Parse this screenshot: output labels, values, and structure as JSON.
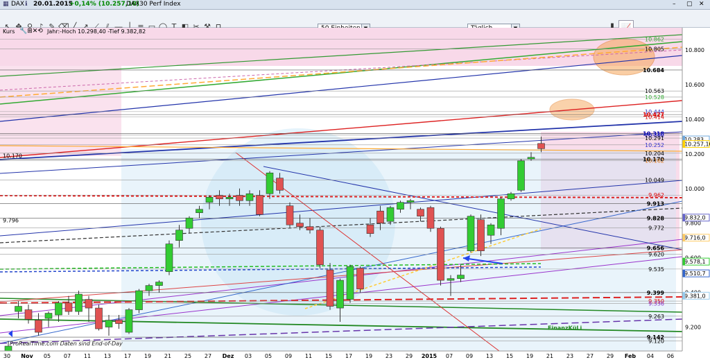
{
  "window": {
    "symbol": "DAX",
    "info_icon": "info-icon",
    "date": "20.01.2015",
    "change": "+0,14% (10.257,10)",
    "title": "DAX30 Perf Index"
  },
  "toolbar": {
    "units_select": "50 Einheiten",
    "period_select": "Täglich"
  },
  "panel": {
    "kurs_label": "Kurs",
    "stats": "Jahr:-Hoch 10.298,40 -Tief 9.382,82"
  },
  "watermark": "ProRealTime.com  Daten sind End-of-Day",
  "colors": {
    "up": "#33cc33",
    "down": "#e05252",
    "pink_zone": "#f6cfe3",
    "blue_zone": "#cfe6f7"
  },
  "chart_data": {
    "type": "candlestick",
    "title": "",
    "x_ticks": [
      "30",
      "Nov",
      "05",
      "07",
      "11",
      "13",
      "17",
      "19",
      "21",
      "25",
      "27",
      "Dez",
      "03",
      "05",
      "09",
      "11",
      "15",
      "17",
      "19",
      "23",
      "29",
      "2015",
      "07",
      "09",
      "13",
      "15",
      "19",
      "21",
      "23",
      "27",
      "29",
      "Feb",
      "04",
      "06"
    ],
    "y_ticks": [
      9200,
      9400,
      9600,
      9800,
      10000,
      10200,
      10400,
      10600,
      10800
    ],
    "ylim": [
      9070,
      10880
    ],
    "candles": [
      {
        "o": 9030,
        "h": 9120,
        "l": 9000,
        "c": 9090
      },
      {
        "o": 9290,
        "h": 9350,
        "l": 9250,
        "c": 9320
      },
      {
        "o": 9300,
        "h": 9330,
        "l": 9220,
        "c": 9245
      },
      {
        "o": 9240,
        "h": 9280,
        "l": 9150,
        "c": 9170
      },
      {
        "o": 9250,
        "h": 9290,
        "l": 9200,
        "c": 9280
      },
      {
        "o": 9270,
        "h": 9350,
        "l": 9230,
        "c": 9340
      },
      {
        "o": 9340,
        "h": 9380,
        "l": 9270,
        "c": 9290
      },
      {
        "o": 9290,
        "h": 9410,
        "l": 9270,
        "c": 9390
      },
      {
        "o": 9360,
        "h": 9380,
        "l": 9230,
        "c": 9310
      },
      {
        "o": 9310,
        "h": 9330,
        "l": 9180,
        "c": 9190
      },
      {
        "o": 9200,
        "h": 9270,
        "l": 9150,
        "c": 9240
      },
      {
        "o": 9240,
        "h": 9270,
        "l": 9190,
        "c": 9220
      },
      {
        "o": 9170,
        "h": 9310,
        "l": 9160,
        "c": 9300
      },
      {
        "o": 9300,
        "h": 9420,
        "l": 9280,
        "c": 9410
      },
      {
        "o": 9410,
        "h": 9450,
        "l": 9380,
        "c": 9440
      },
      {
        "o": 9440,
        "h": 9470,
        "l": 9400,
        "c": 9460
      },
      {
        "o": 9520,
        "h": 9700,
        "l": 9500,
        "c": 9680
      },
      {
        "o": 9700,
        "h": 9790,
        "l": 9660,
        "c": 9760
      },
      {
        "o": 9770,
        "h": 9840,
        "l": 9740,
        "c": 9830
      },
      {
        "o": 9860,
        "h": 9900,
        "l": 9830,
        "c": 9880
      },
      {
        "o": 9920,
        "h": 9960,
        "l": 9880,
        "c": 9950
      },
      {
        "o": 9960,
        "h": 9990,
        "l": 9900,
        "c": 9940
      },
      {
        "o": 9940,
        "h": 9970,
        "l": 9900,
        "c": 9950
      },
      {
        "o": 9960,
        "h": 10000,
        "l": 9900,
        "c": 9930
      },
      {
        "o": 9930,
        "h": 9990,
        "l": 9900,
        "c": 9970
      },
      {
        "o": 9960,
        "h": 9990,
        "l": 9840,
        "c": 9850
      },
      {
        "o": 9970,
        "h": 10100,
        "l": 9940,
        "c": 10090
      },
      {
        "o": 10060,
        "h": 10090,
        "l": 9970,
        "c": 9990
      },
      {
        "o": 9900,
        "h": 9920,
        "l": 9770,
        "c": 9790
      },
      {
        "o": 9800,
        "h": 9850,
        "l": 9760,
        "c": 9780
      },
      {
        "o": 9780,
        "h": 9830,
        "l": 9740,
        "c": 9760
      },
      {
        "o": 9760,
        "h": 9780,
        "l": 9540,
        "c": 9560
      },
      {
        "o": 9530,
        "h": 9570,
        "l": 9300,
        "c": 9320
      },
      {
        "o": 9310,
        "h": 9480,
        "l": 9230,
        "c": 9470
      },
      {
        "o": 9360,
        "h": 9560,
        "l": 9340,
        "c": 9550
      },
      {
        "o": 9540,
        "h": 9550,
        "l": 9400,
        "c": 9420
      },
      {
        "o": 9790,
        "h": 9830,
        "l": 9720,
        "c": 9740
      },
      {
        "o": 9870,
        "h": 9900,
        "l": 9760,
        "c": 9800
      },
      {
        "o": 9810,
        "h": 9900,
        "l": 9790,
        "c": 9890
      },
      {
        "o": 9880,
        "h": 9930,
        "l": 9860,
        "c": 9920
      },
      {
        "o": 9920,
        "h": 9940,
        "l": 9880,
        "c": 9930
      },
      {
        "o": 9880,
        "h": 9890,
        "l": 9810,
        "c": 9840
      },
      {
        "o": 9890,
        "h": 9900,
        "l": 9750,
        "c": 9770
      },
      {
        "o": 9770,
        "h": 9780,
        "l": 9440,
        "c": 9470
      },
      {
        "o": 9470,
        "h": 9500,
        "l": 9380,
        "c": 9480
      },
      {
        "o": 9480,
        "h": 9560,
        "l": 9460,
        "c": 9500
      },
      {
        "o": 9640,
        "h": 9850,
        "l": 9630,
        "c": 9840
      },
      {
        "o": 9820,
        "h": 9850,
        "l": 9610,
        "c": 9640
      },
      {
        "o": 9730,
        "h": 9800,
        "l": 9680,
        "c": 9790
      },
      {
        "o": 9770,
        "h": 9950,
        "l": 9730,
        "c": 9940
      },
      {
        "o": 9940,
        "h": 9980,
        "l": 9930,
        "c": 9970
      },
      {
        "o": 9990,
        "h": 10170,
        "l": 9980,
        "c": 10160
      },
      {
        "o": 10170,
        "h": 10210,
        "l": 10160,
        "c": 10180
      },
      {
        "o": 10260,
        "h": 10300,
        "l": 10210,
        "c": 10230
      }
    ],
    "price_labels_right": [
      {
        "label": "10.800",
        "y": 10800
      },
      {
        "label": "10.600",
        "y": 10600
      },
      {
        "label": "10.400",
        "y": 10400
      },
      {
        "label": "10.200",
        "y": 10200
      },
      {
        "label": "10.000",
        "y": 10000
      },
      {
        "label": "9.800",
        "y": 9800
      },
      {
        "label": "9.600",
        "y": 9600
      },
      {
        "label": "9.400",
        "y": 9400
      },
      {
        "label": "9.200",
        "y": 9200
      }
    ],
    "boxed_labels": [
      {
        "label": "10.283",
        "y": 10283,
        "color": "#6fa8dc"
      },
      {
        "label": "10.257,10",
        "y": 10257,
        "color": "#ffd200"
      },
      {
        "label": "9.832,0",
        "y": 9832,
        "color": "#6666cc"
      },
      {
        "label": "9.716,0",
        "y": 9716,
        "color": "#ffcc66"
      },
      {
        "label": "9.578,1",
        "y": 9578,
        "color": "#33cc33"
      },
      {
        "label": "9.510,7",
        "y": 9510,
        "color": "#3366cc"
      },
      {
        "label": "9.381,0",
        "y": 9381,
        "color": "#99ccee"
      }
    ],
    "level_labels": [
      {
        "label": "10.862",
        "y": 10862,
        "color": "#33aa33"
      },
      {
        "label": "10.805",
        "y": 10805,
        "color": "#000"
      },
      {
        "label": "10.684",
        "y": 10684,
        "color": "#000",
        "bold": true
      },
      {
        "label": "10.563",
        "y": 10563,
        "color": "#000"
      },
      {
        "label": "10.528",
        "y": 10528,
        "color": "#33aa33"
      },
      {
        "label": "10.444",
        "y": 10444,
        "color": "#3333cc"
      },
      {
        "label": "10.427",
        "y": 10427,
        "color": "#dd0000",
        "bold": true
      },
      {
        "label": "10.414",
        "y": 10414,
        "color": "#dd0000"
      },
      {
        "label": "10.318",
        "y": 10318,
        "color": "#0000aa",
        "bold": true
      },
      {
        "label": "10.308",
        "y": 10308,
        "color": "#3333cc"
      },
      {
        "label": "10.291",
        "y": 10291,
        "color": "#000"
      },
      {
        "label": "10.252",
        "y": 10252,
        "color": "#3333cc"
      },
      {
        "label": "10.204",
        "y": 10204,
        "color": "#000"
      },
      {
        "label": "10.170",
        "y": 10170,
        "color": "#000",
        "bold": true
      },
      {
        "label": "10.162",
        "y": 10162,
        "color": "#e08020"
      },
      {
        "label": "10.049",
        "y": 10049,
        "color": "#000"
      },
      {
        "label": "9.962",
        "y": 9962,
        "color": "#dd0000"
      },
      {
        "label": "9.913",
        "y": 9913,
        "color": "#000",
        "bold": true
      },
      {
        "label": "9.828",
        "y": 9828,
        "color": "#000",
        "bold": true
      },
      {
        "label": "9.772",
        "y": 9772,
        "color": "#000"
      },
      {
        "label": "9.656",
        "y": 9656,
        "color": "#000",
        "bold": true
      },
      {
        "label": "9.620",
        "y": 9620,
        "color": "#000"
      },
      {
        "label": "9.535",
        "y": 9535,
        "color": "#000"
      },
      {
        "label": "9.399",
        "y": 9399,
        "color": "#000",
        "bold": true
      },
      {
        "label": "9.350",
        "y": 9350,
        "color": "#dd0000"
      },
      {
        "label": "9.336",
        "y": 9336,
        "color": "#8833cc"
      },
      {
        "label": "9.263",
        "y": 9263,
        "color": "#000"
      },
      {
        "label": "9.142",
        "y": 9142,
        "color": "#000",
        "bold": true
      },
      {
        "label": "9.120",
        "y": 9120,
        "color": "#000"
      }
    ],
    "left_labels": [
      {
        "label": "10.170",
        "y": 10170
      },
      {
        "label": "9.796",
        "y": 9796
      }
    ],
    "annotations": [
      {
        "label": "FinanzKüLi",
        "color": "#228822"
      }
    ]
  }
}
